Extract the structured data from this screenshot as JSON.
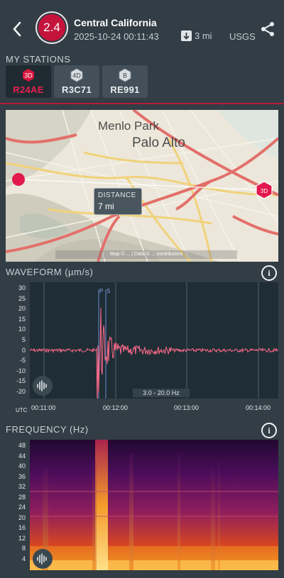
{
  "header": {
    "magnitude": "2.4",
    "region": "Central California",
    "datetime": "2025-10-24 00:11:43",
    "depth": "3 mi",
    "source": "USGS"
  },
  "stations_section": {
    "label": "MY STATIONS",
    "stations": [
      {
        "badge": "3D",
        "label": "R24AE",
        "active": true
      },
      {
        "badge": "4D",
        "label": "R3C71",
        "active": false
      },
      {
        "badge": "B",
        "label": "RE991",
        "active": false
      }
    ]
  },
  "map": {
    "labels": [
      "Menlo Park",
      "Palo Alto"
    ],
    "distance_label": "DISTANCE",
    "distance_value": "7 mi",
    "station_badge": "3D",
    "attribution": "Map © ... | Data © ... contributors"
  },
  "waveform": {
    "title": "WAVEFORM (µm/s)",
    "y_ticks": [
      "30",
      "25",
      "20",
      "15",
      "10",
      "5",
      "0",
      "-5",
      "-10",
      "-15",
      "-20"
    ],
    "x_unit": "UTC",
    "x_ticks": [
      "00:11:00",
      "00:12:00",
      "00:13:00",
      "00:14:00"
    ],
    "p_label": "P",
    "s_label": "S",
    "filter": "3.0 - 20.0 Hz"
  },
  "frequency": {
    "title": "FREQUENCY (Hz)",
    "y_ticks": [
      "48",
      "44",
      "40",
      "36",
      "32",
      "28",
      "24",
      "20",
      "16",
      "12",
      "8",
      "4"
    ]
  },
  "colors": {
    "accent": "#c4143c",
    "trace": "#ff6b8a",
    "background": "#323d45"
  }
}
